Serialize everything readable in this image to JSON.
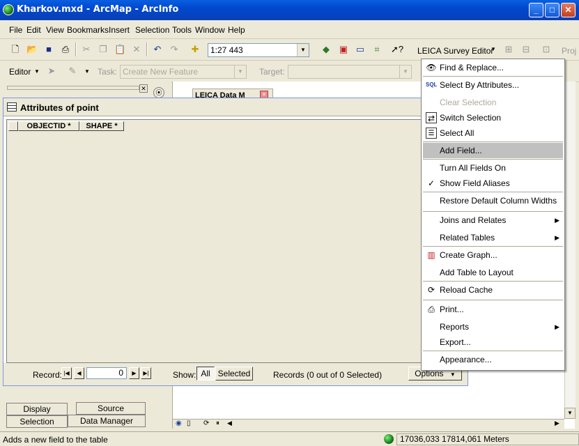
{
  "window": {
    "title": "Kharkov.mxd - ArcMap - ArcInfo",
    "minimize": "_",
    "maximize": "□",
    "close": "✕"
  },
  "menubar": {
    "items": [
      "File",
      "Edit",
      "View",
      "Bookmarks",
      "Insert",
      "Selection",
      "Tools",
      "Window",
      "Help"
    ]
  },
  "standard_toolbar": {
    "scale_value": "1:27 443",
    "leica_label": "LEICA Survey Editor",
    "proj_label": "Proj"
  },
  "editor_toolbar": {
    "editor_label": "Editor",
    "task_label": "Task:",
    "task_value": "Create New Feature",
    "target_label": "Target:"
  },
  "attributes": {
    "title": "Attributes of point",
    "columns": [
      "OBJECTID *",
      "SHAPE *"
    ],
    "record_label": "Record:",
    "record_value": "0",
    "show_label": "Show:",
    "show_all": "All",
    "show_selected": "Selected",
    "records_status": "Records (0 out of 0 Selected)",
    "options_label": "Options"
  },
  "map": {
    "layer_tab": "LEICA Data M"
  },
  "toc_tabs": {
    "display": "Display",
    "source": "Source",
    "selection": "Selection",
    "data_manager": "Data Manager"
  },
  "context_menu": {
    "items": [
      {
        "label": "Find & Replace...",
        "icon": "binoculars-icon"
      },
      {
        "label": "Select By Attributes...",
        "icon": "sql-icon"
      },
      {
        "label": "Clear Selection",
        "icon": "",
        "disabled": true
      },
      {
        "label": "Switch Selection",
        "icon": "switch-selection-icon"
      },
      {
        "label": "Select All",
        "icon": "select-all-icon"
      },
      {
        "label": "Add Field...",
        "icon": "",
        "highlighted": true
      },
      {
        "label": "Turn All Fields On",
        "icon": ""
      },
      {
        "label": "Show Field Aliases",
        "icon": "checkmark-icon"
      },
      {
        "label": "Restore Default Column Widths",
        "icon": ""
      },
      {
        "label": "Joins and Relates",
        "icon": "",
        "submenu": true
      },
      {
        "label": "Related Tables",
        "icon": "",
        "submenu": true
      },
      {
        "label": "Create Graph...",
        "icon": "graph-icon"
      },
      {
        "label": "Add Table to Layout",
        "icon": ""
      },
      {
        "label": "Reload Cache",
        "icon": "reload-icon"
      },
      {
        "label": "Print...",
        "icon": "printer-icon"
      },
      {
        "label": "Reports",
        "icon": "",
        "submenu": true
      },
      {
        "label": "Export...",
        "icon": ""
      },
      {
        "label": "Appearance...",
        "icon": ""
      }
    ]
  },
  "statusbar": {
    "message": "Adds a new field to the table",
    "coordinates": "17036,033  17814,061 Meters"
  }
}
